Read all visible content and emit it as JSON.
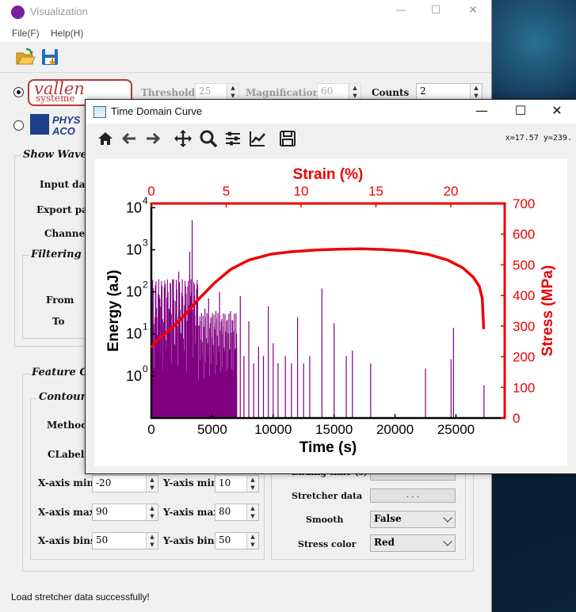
{
  "main_window": {
    "title": "Visualization",
    "controls": {
      "minimize": "—",
      "maximize": "☐",
      "close": "✕"
    },
    "menu": {
      "file": "File(F)",
      "help": "Help(H)"
    },
    "toolbar": {
      "open_icon": "folder-open-icon",
      "save_icon": "save-icon"
    }
  },
  "source": {
    "vallen_logo": {
      "word": "vallen",
      "sub": "systeme",
      "selected": true
    },
    "pac_logo": {
      "line1": "PHYS",
      "line2": "ACO",
      "selected": false
    },
    "threshold_label": "Threshold",
    "threshold_value": "25",
    "magnification_label": "Magnification",
    "magnification_value": "60",
    "counts_label": "Counts",
    "counts_value": "2"
  },
  "waveform_group": {
    "title": "Show Wavef",
    "input_label": "Input dat",
    "export_label": "Export pat",
    "channel_label": "Channel",
    "filtering_title": "Filtering P",
    "from_label": "From",
    "to_label": "To"
  },
  "feature_group": {
    "title": "Feature Cr",
    "contour_title": "Contour",
    "method_label": "Method",
    "clabel_label": "CLabel",
    "x_min_label": "X-axis min",
    "x_min_value": "-20",
    "x_max_label": "X-axis max",
    "x_max_value": "90",
    "x_bins_label": "X-axis bins",
    "x_bins_value": "50",
    "y_min_label": "Y-axis min",
    "y_min_value": "10",
    "y_max_label": "Y-axis max",
    "y_max_value": "80",
    "y_bins_label": "Y-axis bins",
    "y_bins_value": "50",
    "ending_time_label": "Ending time (s)",
    "stretcher_label": "Stretcher data",
    "stretcher_button": ". . .",
    "smooth_label": "Smooth",
    "smooth_value": "False",
    "stress_color_label": "Stress color",
    "stress_color_value": "Red"
  },
  "status": "Load stretcher data successfully!",
  "td_window": {
    "title": "Time Domain Curve",
    "controls": {
      "minimize": "—",
      "maximize": "☐",
      "close": "✕"
    },
    "coords": "x=17.57 y=239.",
    "tools": [
      "home-icon",
      "back-icon",
      "forward-icon",
      "pan-icon",
      "zoom-icon",
      "configure-subplots-icon",
      "edit-axis-icon",
      "save-figure-icon"
    ]
  },
  "chart_data": {
    "type": "bar",
    "xlabel": "Time (s)",
    "ylabel": "Energy (aJ)",
    "y2label": "Stress (MPa)",
    "x2label": "Strain (%)",
    "xlim": [
      0,
      29000
    ],
    "ylim_log10": [
      -1,
      4.1
    ],
    "y_scale": "log",
    "y2lim": [
      0,
      700
    ],
    "x2lim": [
      0,
      23.6
    ],
    "xticks": [
      "0",
      "5000",
      "10000",
      "15000",
      "20000",
      "25000"
    ],
    "xtick_values": [
      0,
      5000,
      10000,
      15000,
      20000,
      25000
    ],
    "yticks": [
      "10",
      "10",
      "10",
      "10",
      "10"
    ],
    "ytick_exponents": [
      "0",
      "1",
      "2",
      "3",
      "4"
    ],
    "y2ticks": [
      "0",
      "100",
      "200",
      "300",
      "400",
      "500",
      "600",
      "700"
    ],
    "x2ticks": [
      "0",
      "5",
      "10",
      "15",
      "20"
    ],
    "bar_color": "#800080",
    "stress_color": "#ee0000",
    "bars": [
      {
        "t": 150,
        "e": 12
      },
      {
        "t": 300,
        "e": 3
      },
      {
        "t": 450,
        "e": 25
      },
      {
        "t": 600,
        "e": 5
      },
      {
        "t": 700,
        "e": 70
      },
      {
        "t": 850,
        "e": 4
      },
      {
        "t": 1000,
        "e": 15
      },
      {
        "t": 1150,
        "e": 150
      },
      {
        "t": 1300,
        "e": 6
      },
      {
        "t": 1450,
        "e": 40
      },
      {
        "t": 1600,
        "e": 3
      },
      {
        "t": 1750,
        "e": 200
      },
      {
        "t": 1850,
        "e": 8
      },
      {
        "t": 2000,
        "e": 30
      },
      {
        "t": 2100,
        "e": 5
      },
      {
        "t": 2250,
        "e": 300
      },
      {
        "t": 2400,
        "e": 10
      },
      {
        "t": 2550,
        "e": 60
      },
      {
        "t": 2700,
        "e": 4
      },
      {
        "t": 2850,
        "e": 90
      },
      {
        "t": 3000,
        "e": 7
      },
      {
        "t": 3150,
        "e": 900
      },
      {
        "t": 3250,
        "e": 20
      },
      {
        "t": 3350,
        "e": 5000
      },
      {
        "t": 3450,
        "e": 30
      },
      {
        "t": 3550,
        "e": 80
      },
      {
        "t": 3650,
        "e": 6
      },
      {
        "t": 3800,
        "e": 150
      },
      {
        "t": 3950,
        "e": 10
      },
      {
        "t": 4100,
        "e": 20
      },
      {
        "t": 4250,
        "e": 4
      },
      {
        "t": 4400,
        "e": 40
      },
      {
        "t": 4550,
        "e": 8
      },
      {
        "t": 4700,
        "e": 70
      },
      {
        "t": 4850,
        "e": 5
      },
      {
        "t": 5000,
        "e": 25
      },
      {
        "t": 5150,
        "e": 15
      },
      {
        "t": 5300,
        "e": 35
      },
      {
        "t": 5450,
        "e": 6
      },
      {
        "t": 5600,
        "e": 100
      },
      {
        "t": 5750,
        "e": 8
      },
      {
        "t": 5900,
        "e": 15
      },
      {
        "t": 6050,
        "e": 4
      },
      {
        "t": 6200,
        "e": 20
      },
      {
        "t": 6350,
        "e": 10
      },
      {
        "t": 6500,
        "e": 35
      },
      {
        "t": 6650,
        "e": 3
      },
      {
        "t": 6800,
        "e": 12
      },
      {
        "t": 7000,
        "e": 5
      },
      {
        "t": 7300,
        "e": 80
      },
      {
        "t": 7600,
        "e": 3
      },
      {
        "t": 8000,
        "e": 20
      },
      {
        "t": 8400,
        "e": 2
      },
      {
        "t": 8800,
        "e": 5
      },
      {
        "t": 9200,
        "e": 3
      },
      {
        "t": 9600,
        "e": 45
      },
      {
        "t": 10000,
        "e": 6
      },
      {
        "t": 10400,
        "e": 2
      },
      {
        "t": 11000,
        "e": 3
      },
      {
        "t": 11500,
        "e": 2
      },
      {
        "t": 12000,
        "e": 25
      },
      {
        "t": 12500,
        "e": 2
      },
      {
        "t": 13000,
        "e": 3
      },
      {
        "t": 14000,
        "e": 120
      },
      {
        "t": 15000,
        "e": 18
      },
      {
        "t": 16000,
        "e": 3
      },
      {
        "t": 16500,
        "e": 4
      },
      {
        "t": 18000,
        "e": 2
      },
      {
        "t": 22500,
        "e": 1.5
      },
      {
        "t": 24600,
        "e": 2.5
      },
      {
        "t": 24800,
        "e": 14
      },
      {
        "t": 27300,
        "e": 0.6
      }
    ],
    "stress_curve": [
      {
        "strain": 0.0,
        "stress": 230
      },
      {
        "strain": 0.3,
        "stress": 250
      },
      {
        "strain": 0.8,
        "stress": 270
      },
      {
        "strain": 1.5,
        "stress": 300
      },
      {
        "strain": 2.3,
        "stress": 340
      },
      {
        "strain": 3.2,
        "stress": 390
      },
      {
        "strain": 4.2,
        "stress": 440
      },
      {
        "strain": 5.3,
        "stress": 485
      },
      {
        "strain": 6.5,
        "stress": 515
      },
      {
        "strain": 8.0,
        "stress": 535
      },
      {
        "strain": 9.5,
        "stress": 543
      },
      {
        "strain": 11.0,
        "stress": 548
      },
      {
        "strain": 12.5,
        "stress": 551
      },
      {
        "strain": 14.0,
        "stress": 552
      },
      {
        "strain": 15.5,
        "stress": 550
      },
      {
        "strain": 17.0,
        "stress": 545
      },
      {
        "strain": 18.5,
        "stress": 534
      },
      {
        "strain": 19.8,
        "stress": 515
      },
      {
        "strain": 20.8,
        "stress": 490
      },
      {
        "strain": 21.5,
        "stress": 460
      },
      {
        "strain": 21.9,
        "stress": 430
      },
      {
        "strain": 22.1,
        "stress": 390
      },
      {
        "strain": 22.15,
        "stress": 340
      },
      {
        "strain": 22.2,
        "stress": 290
      }
    ]
  }
}
